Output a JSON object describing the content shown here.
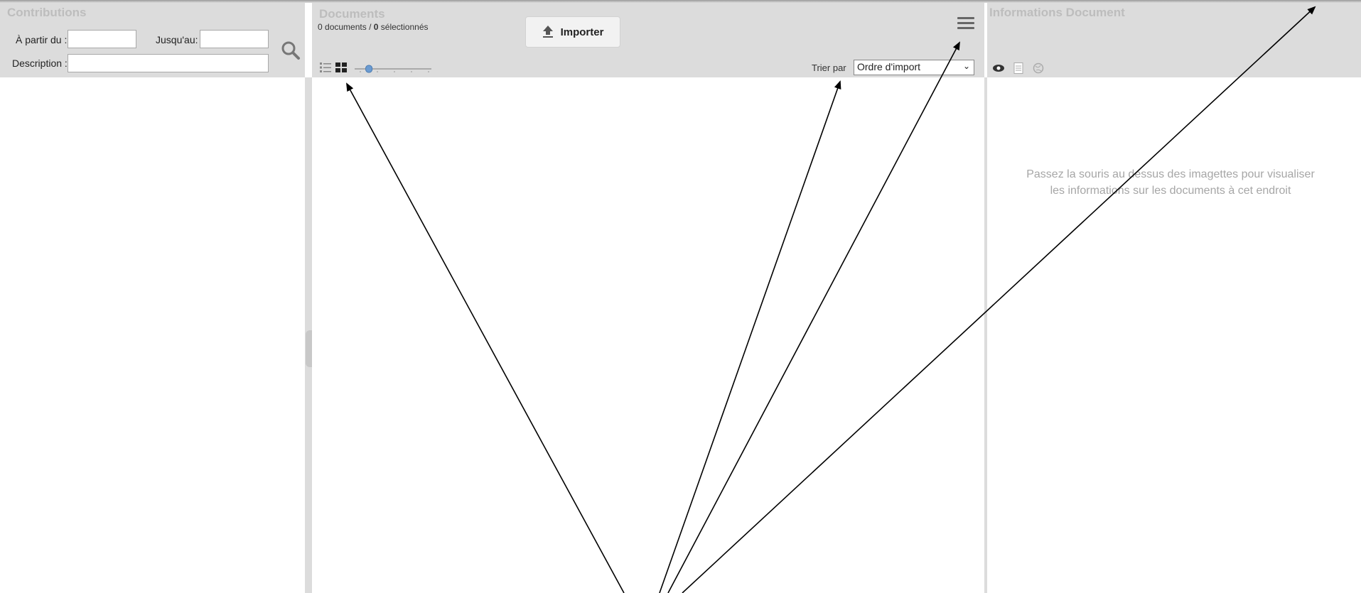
{
  "left": {
    "title": "Contributions",
    "from_label": "À partir du :",
    "to_label": "Jusqu'au:",
    "description_label": "Description :",
    "from_value": "",
    "to_value": "",
    "description_value": "",
    "search_icon": "search-icon"
  },
  "middle": {
    "title": "Documents",
    "count_docs": "0",
    "count_docs_suffix": "documents /",
    "count_selected": "0",
    "count_selected_suffix": "sélectionnés",
    "import_label": "Importer",
    "import_icon": "upload-icon",
    "menu_icon": "hamburger-icon",
    "view_icons": [
      "list-view-icon",
      "grid-view-icon"
    ],
    "sort_label": "Trier par",
    "sort_value": "Ordre d'import",
    "zoom_level": 0.15
  },
  "right": {
    "title": "Informations Document",
    "icons": [
      "eye-icon",
      "document-icon",
      "globe-icon"
    ],
    "hint_line1": "Passez la souris au dessus des imagettes pour visualiser",
    "hint_line2": "les informations sur les documents à cet endroit"
  },
  "colors": {
    "header_bg": "#dcdcdc",
    "title_color": "#bdbdbd",
    "hint_color": "#a6a6a6",
    "slider_accent": "#6b9bd1"
  }
}
